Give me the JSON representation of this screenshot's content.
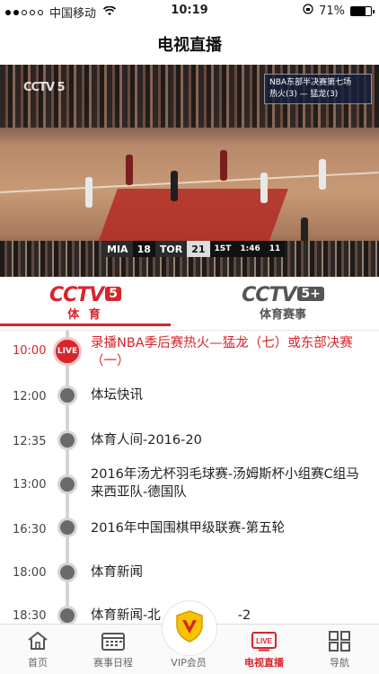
{
  "status_bar": {
    "carrier": "中国移动",
    "time": "10:19",
    "battery_percent": "71%",
    "battery_level": 0.71
  },
  "header": {
    "title": "电视直播"
  },
  "video": {
    "channel_bug": "CCTV 5",
    "info_title": "NBA东部半决赛第七场",
    "info_matchup": "热火(3) — 猛龙(3)",
    "score": {
      "team1": "MIA",
      "score1": "18",
      "team2": "TOR",
      "score2": "21",
      "quarter": "1ST",
      "clock": "1:46",
      "shot": "11"
    }
  },
  "channels": [
    {
      "logo": "CCTV",
      "num": "5",
      "sub": "体 育",
      "active": true
    },
    {
      "logo": "CCTV",
      "num": "5+",
      "sub": "体育赛事",
      "active": false
    }
  ],
  "schedule": {
    "live_badge": "LIVE",
    "items": [
      {
        "time": "10:00",
        "program": "录播NBA季后赛热火—猛龙（七）或东部决赛（一）",
        "live": true
      },
      {
        "time": "12:00",
        "program": "体坛快讯",
        "live": false
      },
      {
        "time": "12:35",
        "program": "体育人间-2016-20",
        "live": false
      },
      {
        "time": "13:00",
        "program": "2016年汤尤杯羽毛球赛-汤姆斯杯小组赛C组马来西亚队-德国队",
        "live": false
      },
      {
        "time": "16:30",
        "program": "2016年中国围棋甲级联赛-第五轮",
        "live": false
      },
      {
        "time": "18:00",
        "program": "体育新闻",
        "live": false
      },
      {
        "time": "18:30",
        "program": "体育新闻-北",
        "program_tail": "-2",
        "live": false
      }
    ]
  },
  "tabbar": {
    "items": [
      {
        "label": "首页",
        "icon": "home-icon"
      },
      {
        "label": "赛事日程",
        "icon": "calendar-icon"
      },
      {
        "label": "VIP会员",
        "icon": "vip-shield-icon"
      },
      {
        "label": "电视直播",
        "icon": "live-tv-icon",
        "badge": "LIVE",
        "active": true
      },
      {
        "label": "导航",
        "icon": "grid-icon"
      }
    ]
  },
  "colors": {
    "accent": "#d7252b",
    "timeline": "#d4d4d4",
    "node": "#6a6a6a",
    "vip_yellow": "#f5c400"
  }
}
